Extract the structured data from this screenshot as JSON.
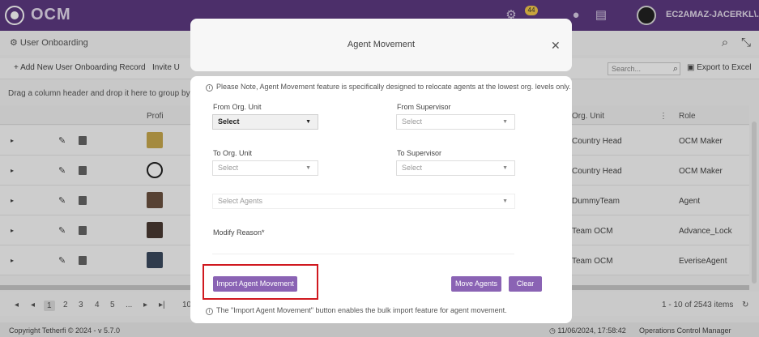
{
  "topbar": {
    "brand": "OCM",
    "notification_count": "44",
    "user_name": "EC2AMAZ-JACERKL\\..."
  },
  "page": {
    "title": "User Onboarding",
    "toolbar": {
      "add_label": "+ Add New User Onboarding Record",
      "invite_label": "Invite U",
      "search_placeholder": "Search...",
      "export_label": "Export to Excel"
    },
    "group_hint": "Drag a column header and drop it here to group by tha",
    "columns": {
      "profile": "Profi",
      "org_unit": "Org. Unit",
      "role": "Role"
    },
    "rows": [
      {
        "org_unit": "Country Head",
        "role": "OCM Maker"
      },
      {
        "org_unit": "Country Head",
        "role": "OCM Maker"
      },
      {
        "org_unit": "DummyTeam",
        "role": "Agent"
      },
      {
        "org_unit": "Team OCM",
        "role": "Advance_Lock"
      },
      {
        "org_unit": "Team OCM",
        "role": "EveriseAgent"
      }
    ],
    "pager": {
      "first": "◂",
      "prev": "◂",
      "pages": [
        "1",
        "2",
        "3",
        "4",
        "5",
        "..."
      ],
      "next": "▸",
      "last": "▸|",
      "per_page": "10",
      "summary": "1 - 10 of 2543 items"
    },
    "footer": {
      "copyright": "Copyright Tetherfi © 2024 - v 5.7.0",
      "datetime": "11/06/2024, 17:58:42",
      "product": "Operations Control Manager"
    }
  },
  "modal": {
    "title": "Agent Movement",
    "note": "Please Note, Agent Movement feature is specifically designed to relocate agents at the lowest org. levels only.",
    "fields": {
      "from_org_unit": {
        "label": "From Org. Unit",
        "value": "Select"
      },
      "from_supervisor": {
        "label": "From Supervisor",
        "placeholder": "Select"
      },
      "to_org_unit": {
        "label": "To Org. Unit",
        "placeholder": "Select"
      },
      "to_supervisor": {
        "label": "To Supervisor",
        "placeholder": "Select"
      },
      "select_agents": {
        "placeholder": "Select Agents"
      },
      "modify_reason": {
        "label": "Modify Reason*"
      }
    },
    "buttons": {
      "import": "Import Agent Movement",
      "move": "Move Agents",
      "clear": "Clear"
    },
    "hint": "The \"Import Agent Movement\" button enables the bulk import feature for agent movement."
  },
  "colors": {
    "topbar": "#5d3a82",
    "button": "#8a63b4",
    "highlight": "#d0191f"
  }
}
